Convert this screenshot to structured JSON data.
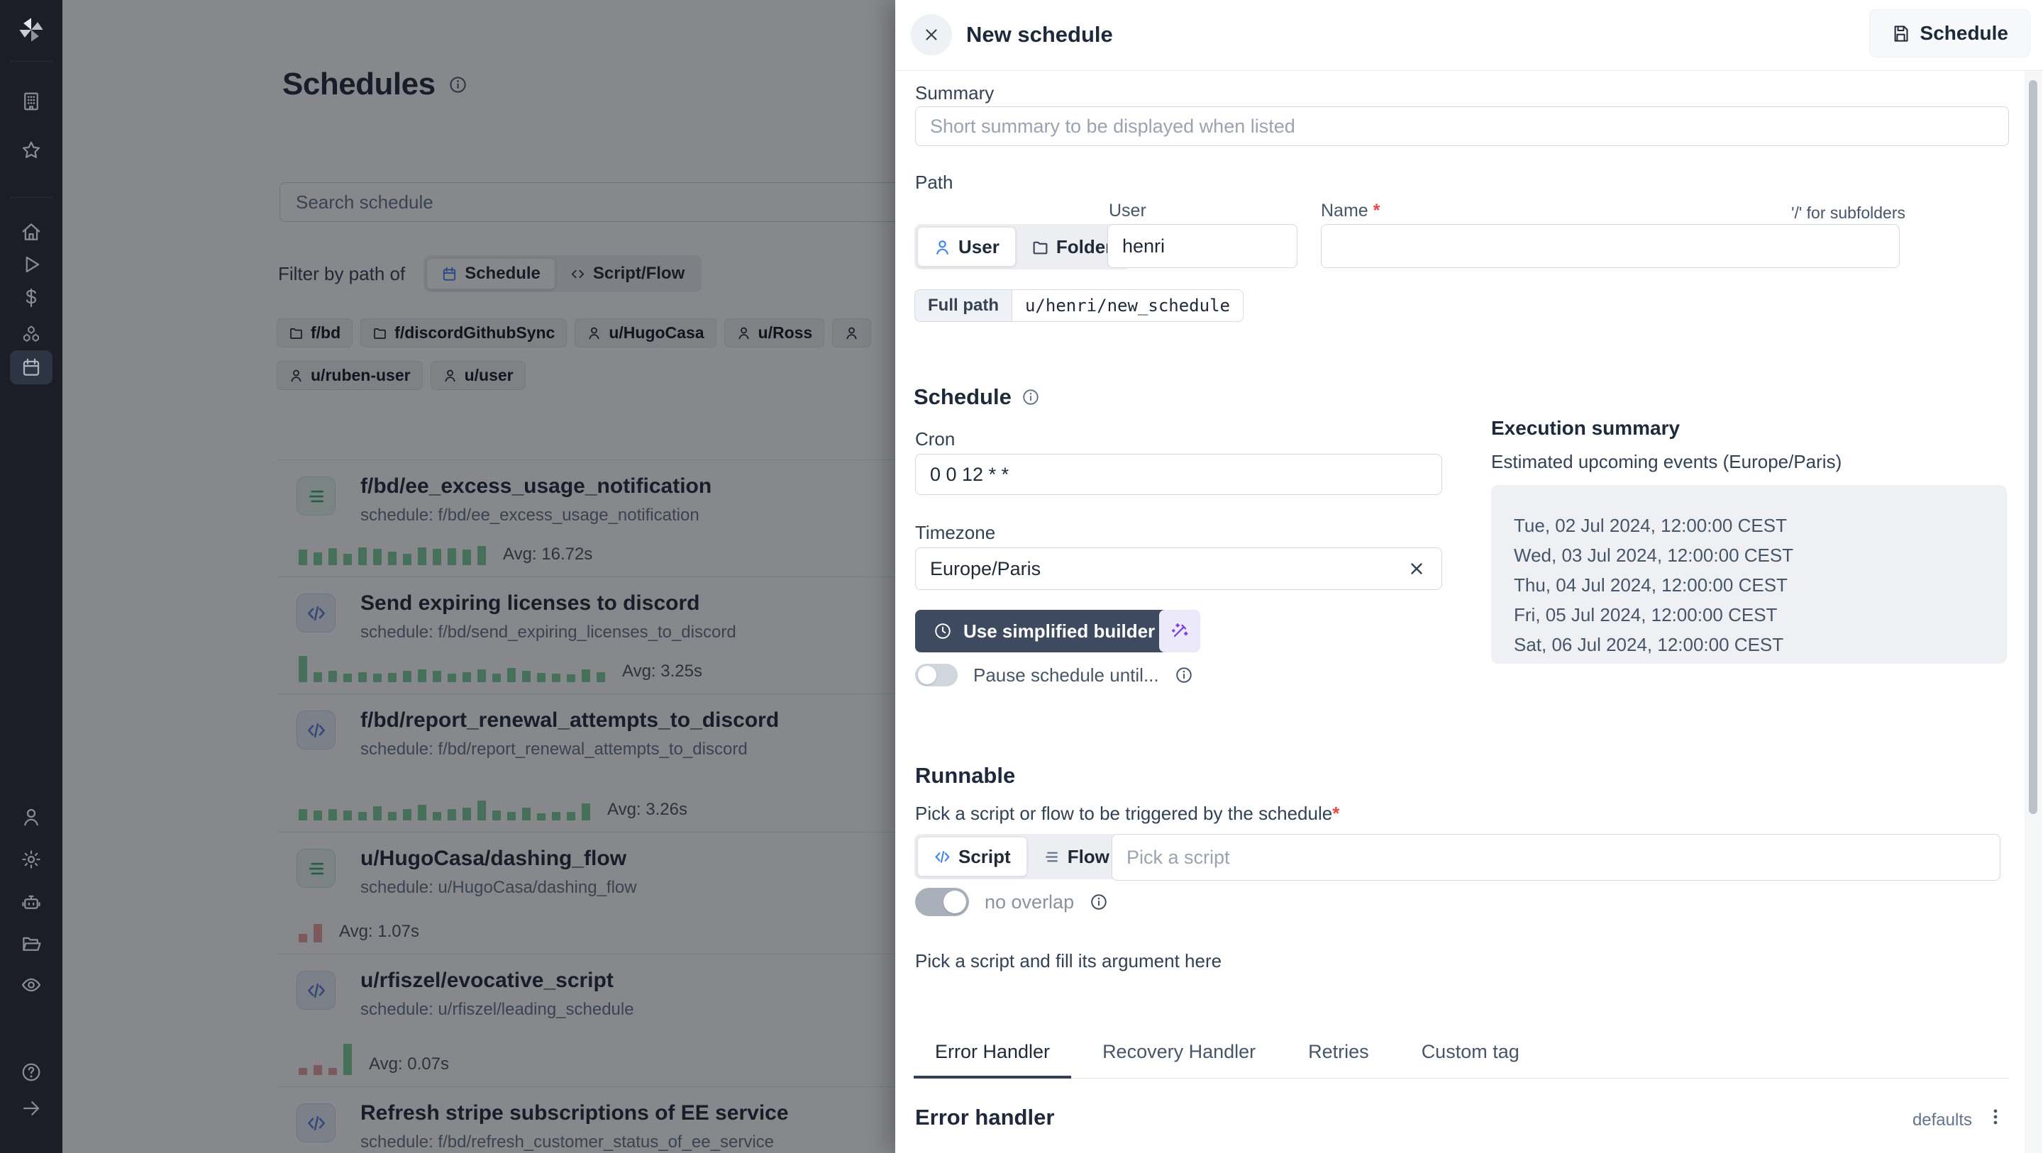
{
  "colors": {
    "accent_blue": "#3b82f6",
    "bar_green": "#7fcf9d",
    "bar_red": "#e8a0a0",
    "dark_button": "#3e4a5f",
    "active_tab_underline": "#334155",
    "sidebar_bg": "#1b1d27"
  },
  "sidebar": {
    "icons": [
      "windmill-logo",
      "building",
      "star",
      "home",
      "play",
      "dollar",
      "cubes",
      "calendar"
    ],
    "bottom_icons": [
      "user",
      "settings",
      "robot",
      "folder-open",
      "eye"
    ],
    "footer_icons": [
      "help",
      "arrow-right"
    ],
    "active_icon": "calendar"
  },
  "page": {
    "title": "Schedules",
    "search_placeholder": "Search schedule",
    "filter_label": "Filter by path of",
    "filter_toggle": {
      "schedule_label": "Schedule",
      "script_flow_label": "Script/Flow"
    },
    "chips": [
      {
        "icon": "folder",
        "label": "f/bd"
      },
      {
        "icon": "folder",
        "label": "f/discordGithubSync"
      },
      {
        "icon": "user",
        "label": "u/HugoCasa"
      },
      {
        "icon": "user",
        "label": "u/Ross"
      },
      {
        "icon": "user",
        "label": ""
      },
      {
        "icon": "user",
        "label": "u/ruben-user"
      },
      {
        "icon": "user",
        "label": "u/user"
      }
    ],
    "schedules": [
      {
        "kind": "flow",
        "title": "f/bd/ee_excess_usage_notification",
        "subtitle": "schedule: f/bd/ee_excess_usage_notification",
        "avg": "Avg: 16.72s",
        "bars": [
          [
            "g",
            22
          ],
          [
            "g",
            18
          ],
          [
            "g",
            24
          ],
          [
            "g",
            16
          ],
          [
            "g",
            25
          ],
          [
            "g",
            23
          ],
          [
            "g",
            19
          ],
          [
            "g",
            16
          ],
          [
            "g",
            25
          ],
          [
            "g",
            23
          ],
          [
            "g",
            24
          ],
          [
            "g",
            22
          ],
          [
            "g",
            27
          ]
        ]
      },
      {
        "kind": "script",
        "title": "Send expiring licenses to discord",
        "subtitle": "schedule: f/bd/send_expiring_licenses_to_discord",
        "avg": "Avg: 3.25s",
        "bars": [
          [
            "g",
            37
          ],
          [
            "g",
            14
          ],
          [
            "g",
            16
          ],
          [
            "g",
            12
          ],
          [
            "g",
            14
          ],
          [
            "g",
            12
          ],
          [
            "g",
            13
          ],
          [
            "g",
            16
          ],
          [
            "g",
            18
          ],
          [
            "g",
            16
          ],
          [
            "g",
            12
          ],
          [
            "g",
            14
          ],
          [
            "g",
            18
          ],
          [
            "g",
            12
          ],
          [
            "g",
            20
          ],
          [
            "g",
            16
          ],
          [
            "g",
            13
          ],
          [
            "g",
            12
          ],
          [
            "g",
            11
          ],
          [
            "g",
            18
          ],
          [
            "g",
            14
          ]
        ]
      },
      {
        "kind": "script",
        "title": "f/bd/report_renewal_attempts_to_discord",
        "subtitle": "schedule: f/bd/report_renewal_attempts_to_discord",
        "avg": "Avg: 3.26s",
        "bars": [
          [
            "g",
            16
          ],
          [
            "g",
            14
          ],
          [
            "g",
            16
          ],
          [
            "g",
            14
          ],
          [
            "g",
            12
          ],
          [
            "g",
            20
          ],
          [
            "g",
            12
          ],
          [
            "g",
            16
          ],
          [
            "g",
            22
          ],
          [
            "g",
            12
          ],
          [
            "g",
            16
          ],
          [
            "g",
            18
          ],
          [
            "g",
            28
          ],
          [
            "g",
            14
          ],
          [
            "g",
            12
          ],
          [
            "g",
            18
          ],
          [
            "g",
            10
          ],
          [
            "g",
            12
          ],
          [
            "g",
            12
          ],
          [
            "g",
            24
          ]
        ]
      },
      {
        "kind": "flow",
        "title": "u/HugoCasa/dashing_flow",
        "subtitle": "schedule: u/HugoCasa/dashing_flow",
        "avg": "Avg: 1.07s",
        "bars": [
          [
            "r",
            12
          ],
          [
            "r",
            26
          ]
        ]
      },
      {
        "kind": "script",
        "title": "u/rfiszel/evocative_script",
        "subtitle": "schedule: u/rfiszel/leading_schedule",
        "avg": "Avg: 0.07s",
        "bars": [
          [
            "r",
            10
          ],
          [
            "r",
            14
          ],
          [
            "r",
            10
          ],
          [
            "g",
            44
          ]
        ]
      },
      {
        "kind": "script",
        "title": "Refresh stripe subscriptions of EE service",
        "subtitle": "schedule: f/bd/refresh_customer_status_of_ee_service",
        "avg": "",
        "bars": []
      }
    ]
  },
  "drawer": {
    "title": "New schedule",
    "action_button": "Schedule",
    "summary": {
      "label": "Summary",
      "placeholder": "Short summary to be displayed when listed"
    },
    "path": {
      "label": "Path",
      "owner_toggle": {
        "user_label": "User",
        "folder_label": "Folder"
      },
      "user_field_label": "User",
      "user_value": "henri",
      "name_label": "Name",
      "required_mark": "*",
      "subfolders_note": "'/' for subfolders",
      "full_path_label": "Full path",
      "full_path_value": "u/henri/new_schedule"
    },
    "schedule": {
      "heading": "Schedule",
      "cron_label": "Cron",
      "cron_value": "0 0 12 * *",
      "timezone_label": "Timezone",
      "timezone_value": "Europe/Paris",
      "builder_button": "Use simplified builder",
      "pause_label": "Pause schedule until...",
      "execution": {
        "heading": "Execution summary",
        "subheading": "Estimated upcoming events (Europe/Paris)",
        "events": [
          "Tue, 02 Jul 2024, 12:00:00 CEST",
          "Wed, 03 Jul 2024, 12:00:00 CEST",
          "Thu, 04 Jul 2024, 12:00:00 CEST",
          "Fri, 05 Jul 2024, 12:00:00 CEST",
          "Sat, 06 Jul 2024, 12:00:00 CEST"
        ]
      }
    },
    "runnable": {
      "heading": "Runnable",
      "description": "Pick a script or flow to be triggered by the schedule",
      "required_mark": "*",
      "kind_toggle": {
        "script_label": "Script",
        "flow_label": "Flow"
      },
      "picker_placeholder": "Pick a script",
      "no_overlap_label": "no overlap",
      "helper": "Pick a script and fill its argument here"
    },
    "tabs": [
      {
        "label": "Error Handler",
        "active": true
      },
      {
        "label": "Recovery Handler",
        "active": false
      },
      {
        "label": "Retries",
        "active": false
      },
      {
        "label": "Custom tag",
        "active": false
      }
    ],
    "error_handler": {
      "heading": "Error handler",
      "defaults_label": "defaults"
    }
  }
}
